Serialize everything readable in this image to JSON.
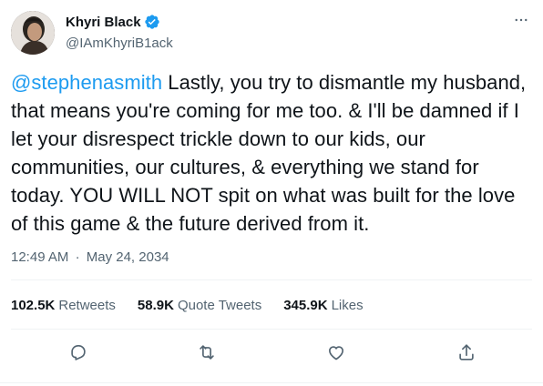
{
  "author": {
    "display_name": "Khyri Black",
    "handle": "@IAmKhyriB1ack",
    "verified": true
  },
  "tweet": {
    "mention": "@stephenasmith",
    "body": " Lastly, you try to dismantle my husband, that means you're coming for me too. & I'll be damned if I let your disrespect trickle down to our kids, our communities, our cultures, & everything we stand for today. YOU WILL NOT spit on what was built for the love of this game & the future derived from it."
  },
  "meta": {
    "time": "12:49 AM",
    "separator": "·",
    "date": "May 24, 2034"
  },
  "stats": {
    "retweets_count": "102.5K",
    "retweets_label": "Retweets",
    "quotes_count": "58.9K",
    "quotes_label": "Quote Tweets",
    "likes_count": "345.9K",
    "likes_label": "Likes"
  },
  "icons": {
    "verified": "verified-badge-icon",
    "more": "more-dots-icon",
    "reply": "reply-icon",
    "retweet": "retweet-icon",
    "like": "heart-icon",
    "share": "share-icon"
  },
  "colors": {
    "accent": "#1d9bf0",
    "text": "#0f1419",
    "secondary": "#536471",
    "divider": "#eff3f4"
  }
}
